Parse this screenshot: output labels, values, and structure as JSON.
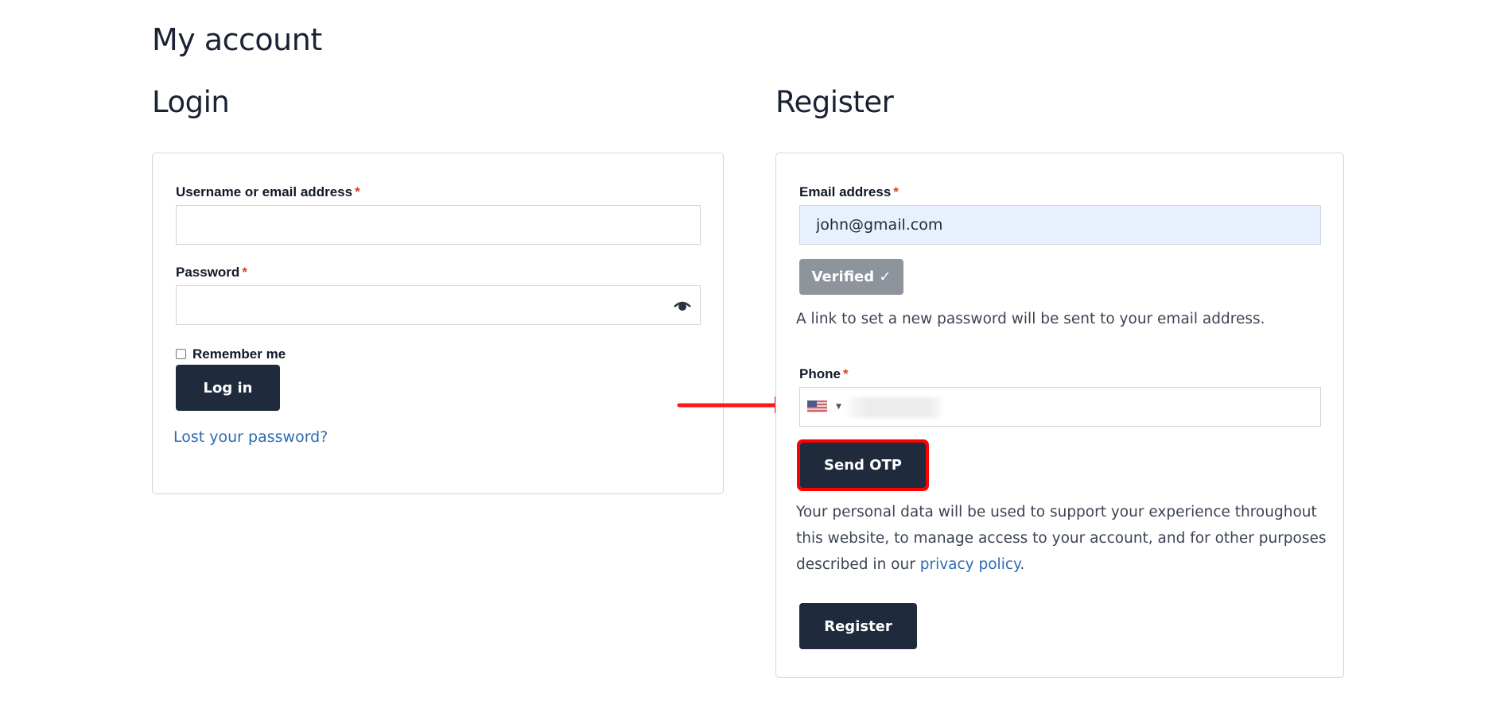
{
  "page": {
    "title": "My account"
  },
  "login": {
    "heading": "Login",
    "username_label": "Username or email address",
    "username_value": "",
    "password_label": "Password",
    "password_value": "",
    "required_marker": "*",
    "password_toggle_icon": "eye-icon",
    "remember_label": "Remember me",
    "remember_checked": false,
    "login_button": "Log in",
    "lost_password_link": "Lost your password?"
  },
  "register": {
    "heading": "Register",
    "email_label": "Email address",
    "email_value": "john@gmail.com",
    "required_marker": "*",
    "verified_button": "Verified ✓",
    "password_note": "A link to set a new password will be sent to your email address.",
    "phone_label": "Phone",
    "phone_country_icon": "us-flag-icon",
    "phone_value": "(redacted)",
    "send_otp_button": "Send OTP",
    "privacy_text_before": "Your personal data will be used to support your experience throughout this website, to manage access to your account, and for other purposes described in our ",
    "privacy_link": "privacy policy",
    "privacy_text_after": ".",
    "register_button": "Register"
  },
  "annotation": {
    "arrow_icon": "red-arrow-icon",
    "highlight_color": "#ff0000"
  },
  "colors": {
    "primary_button": "#1f2a3c",
    "verified_button": "#8e949c",
    "link": "#2c6cb0",
    "required": "#e2401c",
    "autofill_bg": "#e8f0fe"
  }
}
